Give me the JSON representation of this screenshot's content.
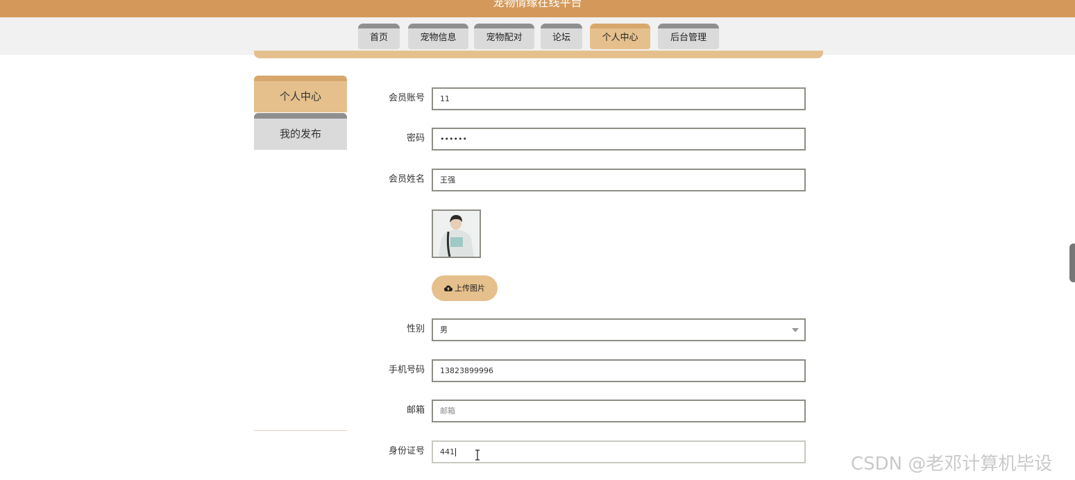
{
  "header": {
    "site_title": "宠物情缘在线平台"
  },
  "nav": {
    "items": [
      {
        "label": "首页"
      },
      {
        "label": "宠物信息"
      },
      {
        "label": "宠物配对"
      },
      {
        "label": "论坛"
      },
      {
        "label": "个人中心",
        "active": true
      },
      {
        "label": "后台管理"
      }
    ]
  },
  "sidebar": {
    "items": [
      {
        "label": "个人中心",
        "active": true
      },
      {
        "label": "我的发布"
      }
    ]
  },
  "form": {
    "account": {
      "label": "会员账号",
      "value": "11"
    },
    "password": {
      "label": "密码",
      "value": "••••••"
    },
    "name": {
      "label": "会员姓名",
      "value": "王强"
    },
    "upload_label": "上传图片",
    "gender": {
      "label": "性别",
      "value": "男"
    },
    "phone": {
      "label": "手机号码",
      "value": "13823899996"
    },
    "email": {
      "label": "邮箱",
      "placeholder": "邮箱"
    },
    "id_card": {
      "label": "身份证号",
      "value": "441"
    }
  },
  "watermark": "CSDN @老邓计算机毕设",
  "colors": {
    "brand": "#d4995a",
    "accent": "#e5c08c",
    "inactive": "#dadada"
  }
}
